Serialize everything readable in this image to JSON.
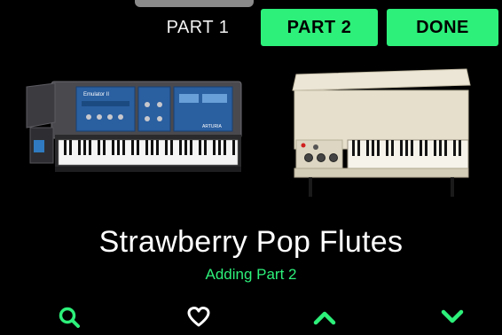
{
  "tabs": {
    "part1_label": "PART 1",
    "part2_label": "PART 2",
    "done_label": "DONE"
  },
  "patch": {
    "name": "Strawberry Pop Flutes",
    "status": "Adding Part 2"
  },
  "instruments": {
    "left_panel_text": "Emulator II",
    "left_brand_text": "ARTURIA"
  },
  "nav": {
    "icons": [
      "search-icon",
      "heart-icon",
      "chevron-up-icon",
      "chevron-down-icon"
    ]
  },
  "colors": {
    "accent": "#2df07a",
    "background": "#000000",
    "text": "#ffffff"
  }
}
